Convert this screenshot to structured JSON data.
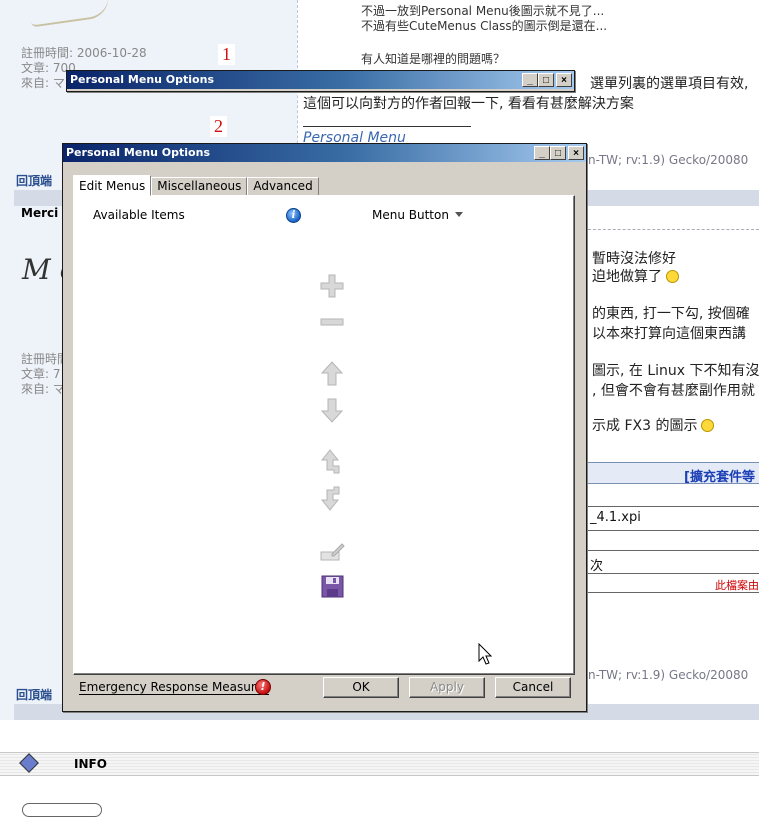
{
  "forum": {
    "post1_meta": [
      "註冊時間: 2006-10-28",
      "文章: 700",
      "來自: マ"
    ],
    "post1_lines": [
      "不過一放到Personal Menu後圖示就不見了...",
      "不過有些CuteMenus Class的圖示倒是還在...",
      "有人知道是哪裡的問題嗎？"
    ],
    "post1_reply_a": "選單列裏的選單項目有效,",
    "post1_reply_b": "這個可以向對方的作者回報一下, 看看有甚麼解決方案",
    "personal_menu_link": "Personal Menu",
    "ua_top": "n-TW; rv:1.9) Gecko/20080",
    "top_link_1": "回頂端",
    "poster_name": "Merci",
    "script_signature": "M ch",
    "post2_meta": [
      "註冊時間",
      "文章: 7",
      "來自: マ"
    ],
    "post2_lines": [
      "暫時沒法修好",
      "迫地做算了",
      "的東西, 打一下勾, 按個確",
      "以本來打算向這個東西講",
      "圖示, 在 Linux 下不知有沒",
      ", 但會不會有甚麼副作用就",
      "示成 FX3 的圖示"
    ],
    "attach_title": "[擴充套件等",
    "attach_file": "_4.1.xpi",
    "attach_count": "次",
    "attach_note": "此檔案由",
    "ua_bottom": "n-TW; rv:1.9) Gecko/20080",
    "top_link_2": "回頂端",
    "info_label": "INFO",
    "marker_1": "1",
    "marker_2": "2"
  },
  "window1": {
    "title": "Personal Menu Options"
  },
  "window2": {
    "title": "Personal Menu Options",
    "tabs": [
      "Edit Menus",
      "Miscellaneous",
      "Advanced"
    ],
    "available_items_label": "Available Items",
    "info_icon_glyph": "i",
    "menu_selector_label": "Menu Button",
    "toolbar_icons": [
      "add-icon",
      "remove-icon",
      "move-up-icon",
      "move-down-icon",
      "move-up-level-icon",
      "move-down-level-icon",
      "edit-icon",
      "save-icon"
    ],
    "footer_link": "Emergency Response Measures",
    "warn_icon_glyph": "!",
    "ok_label": "OK",
    "apply_label": "Apply",
    "cancel_label": "Cancel"
  }
}
